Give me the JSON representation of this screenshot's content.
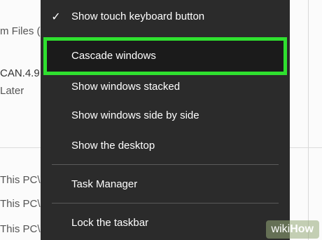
{
  "background": {
    "rows": [
      {
        "text": "m Files (",
        "class": "r1"
      },
      {
        "text": "CAN.4.9",
        "class": "r2"
      },
      {
        "text": "Later",
        "class": "r3"
      },
      {
        "text": "This PC\\",
        "class": "r4"
      },
      {
        "text": "This PC\\",
        "class": "r5"
      },
      {
        "text": "This PC\\",
        "class": "r6"
      }
    ]
  },
  "menu": {
    "items": [
      {
        "label": "Show touch keyboard button",
        "checked": true
      },
      {
        "label": "Cascade windows",
        "highlighted": true
      },
      {
        "label": "Show windows stacked"
      },
      {
        "label": "Show windows side by side"
      },
      {
        "label": "Show the desktop"
      },
      {
        "label": "Task Manager"
      },
      {
        "label": "Lock the taskbar"
      }
    ],
    "check_glyph": "✓"
  },
  "watermark": {
    "part1": "wiki",
    "part2": "How"
  },
  "colors": {
    "menu_bg": "#2b2b2b",
    "highlight_border": "#2fe02f"
  }
}
